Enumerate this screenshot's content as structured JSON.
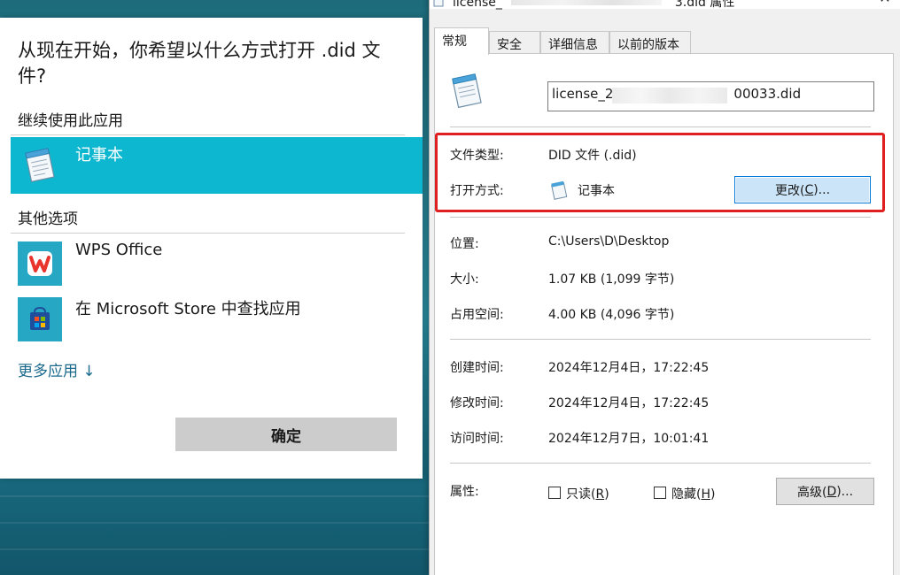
{
  "open_with": {
    "title": "从现在开始，你希望以什么方式打开 .did 文件?",
    "continue_label": "继续使用此应用",
    "current_app": {
      "label": "记事本",
      "icon": "notepad-icon"
    },
    "other_label": "其他选项",
    "other_apps": [
      {
        "label": "WPS Office",
        "icon": "wps-office-icon"
      },
      {
        "label": "在 Microsoft Store 中查找应用",
        "icon": "microsoft-store-icon"
      }
    ],
    "more_apps": "更多应用 ↓",
    "ok_button": "确定",
    "accent_color": "#0cb7cf"
  },
  "properties": {
    "window_title_prefix": "license_",
    "window_title_suffix": "3.did 属性",
    "tabs": [
      {
        "label": "常规",
        "active": true
      },
      {
        "label": "安全",
        "active": false
      },
      {
        "label": "详细信息",
        "active": false
      },
      {
        "label": "以前的版本",
        "active": false
      }
    ],
    "filename_prefix": "license_2",
    "filename_suffix": "00033.did",
    "file_type_label": "文件类型:",
    "file_type_value": "DID 文件 (.did)",
    "opens_with_label": "打开方式:",
    "opens_with_value": "记事本",
    "change_button_text": "更改(",
    "change_button_key": "C",
    "change_button_tail": ")...",
    "location_label": "位置:",
    "location_value": "C:\\Users\\D\\Desktop",
    "size_label": "大小:",
    "size_value": "1.07 KB (1,099 字节)",
    "disk_size_label": "占用空间:",
    "disk_size_value": "4.00 KB (4,096 字节)",
    "created_label": "创建时间:",
    "created_value": "2024年12月4日，17:22:45",
    "modified_label": "修改时间:",
    "modified_value": "2024年12月4日，17:22:45",
    "accessed_label": "访问时间:",
    "accessed_value": "2024年12月7日，10:01:41",
    "attributes_label": "属性:",
    "readonly_text": "只读(",
    "readonly_key": "R",
    "hidden_text": "隐藏(",
    "hidden_key": "H",
    "advanced_text": "高级(",
    "advanced_key": "D",
    "advanced_tail": ")...",
    "highlight_color": "#e02020"
  }
}
